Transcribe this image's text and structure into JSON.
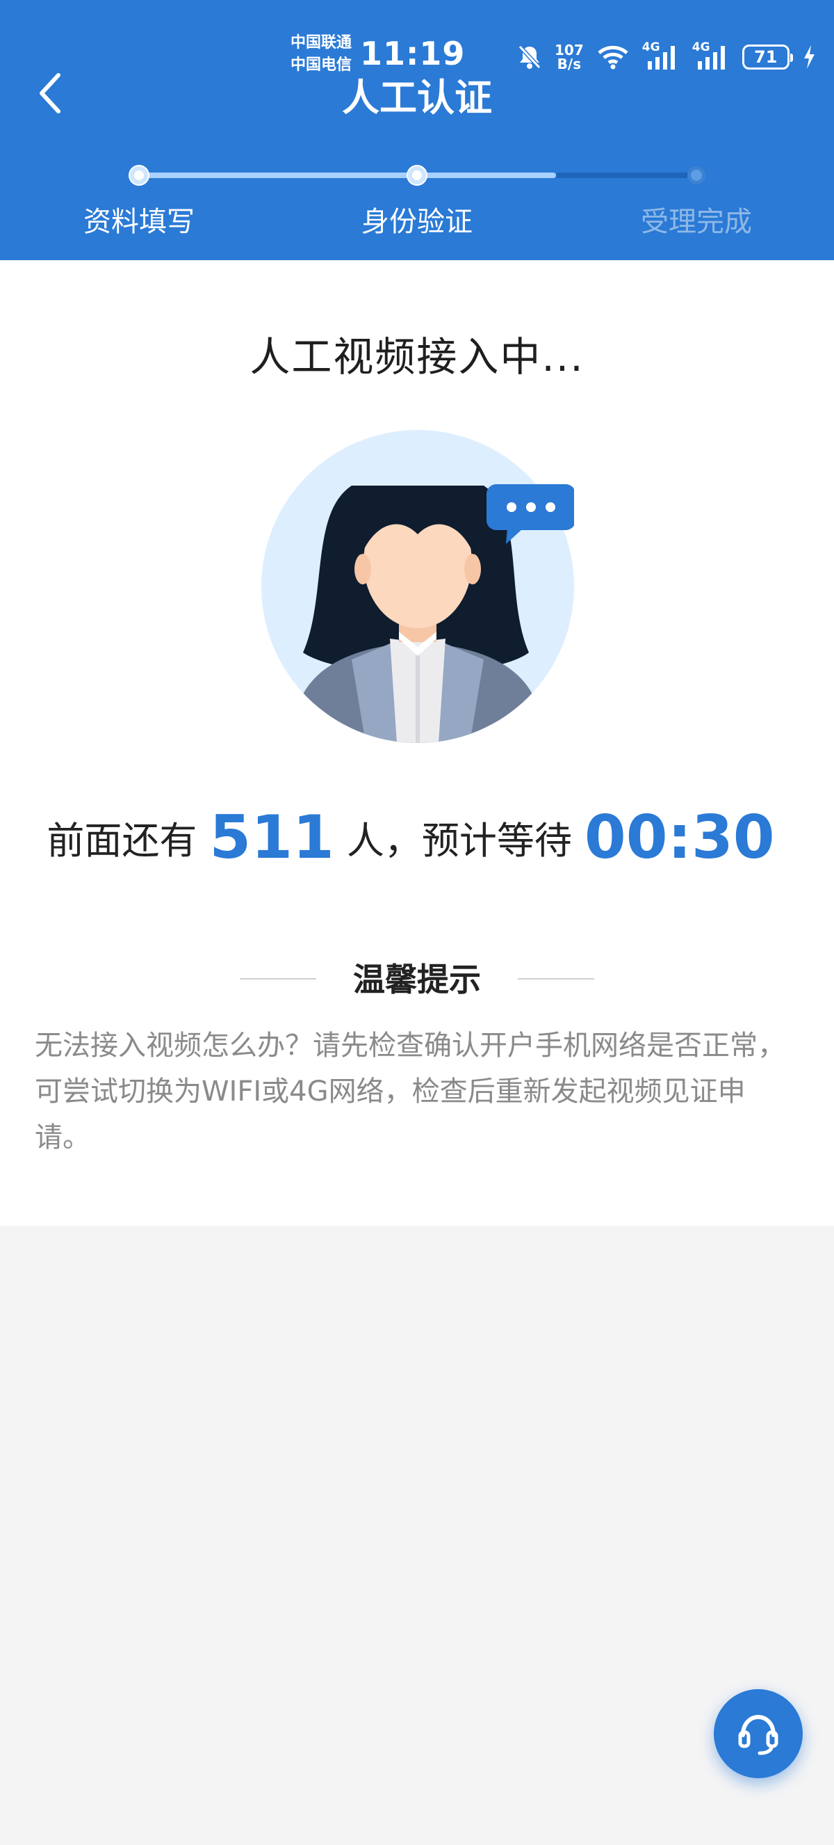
{
  "status_bar": {
    "carrier_1": "中国联通",
    "carrier_2": "中国电信",
    "time": "11:19",
    "net_speed": "107",
    "net_speed_unit": "B/s",
    "sim_1_label": "4G",
    "sim_2_label": "4G",
    "battery": "71"
  },
  "header": {
    "title": "人工认证",
    "back_icon": "chevron-left-icon",
    "background_color": "#2a7ad6"
  },
  "steps": [
    {
      "label": "资料填写",
      "state": "done"
    },
    {
      "label": "身份验证",
      "state": "current"
    },
    {
      "label": "受理完成",
      "state": "pending"
    }
  ],
  "main": {
    "status_heading": "人工视频接入中...",
    "avatar_icon": "customer-service-agent-illustration",
    "queue": {
      "prefix": "前面还有",
      "people_count": "511",
      "middle": "人，预计等待",
      "wait_time": "00:30"
    },
    "tips_title": "温馨提示",
    "tips_text": "无法接入视频怎么办？请先检查确认开户手机网络是否正常，可尝试切换为WIFI或4G网络，检查后重新发起视频见证申请。"
  },
  "floating": {
    "service_icon": "headset-icon"
  }
}
